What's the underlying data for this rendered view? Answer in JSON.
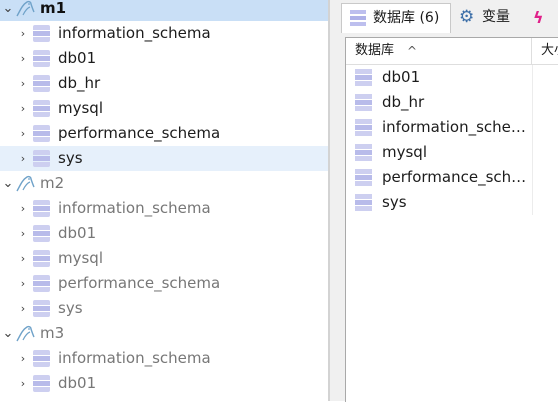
{
  "navigator": {
    "connections": [
      {
        "name": "m1",
        "expanded": true,
        "selected": true,
        "databases": [
          "information_schema",
          "db01",
          "db_hr",
          "mysql",
          "performance_schema",
          "sys"
        ]
      },
      {
        "name": "m2",
        "expanded": true,
        "selected": false,
        "databases": [
          "information_schema",
          "db01",
          "mysql",
          "performance_schema",
          "sys"
        ]
      },
      {
        "name": "m3",
        "expanded": true,
        "selected": false,
        "databases": [
          "information_schema",
          "db01"
        ]
      }
    ]
  },
  "tabs": [
    {
      "label": "数据库 (6)",
      "icon": "database-icon",
      "active": true
    },
    {
      "label": "变量",
      "icon": "gear-icon",
      "active": false
    },
    {
      "label": "",
      "icon": "bolt-icon",
      "active": false
    }
  ],
  "grid": {
    "columns": [
      "数据库",
      "大小"
    ],
    "sort_indicator": "^",
    "rows": [
      "db01",
      "db_hr",
      "information_schema",
      "mysql",
      "performance_schema",
      "sys"
    ]
  },
  "glyphs": {
    "expanded": "⌄",
    "collapsed": "›"
  },
  "colors": {
    "selection": "#c9dff6",
    "hover": "#e6f0fb",
    "db_icon": "#b8bbea",
    "gear": "#3d6fa8",
    "bolt": "#e0218a"
  }
}
